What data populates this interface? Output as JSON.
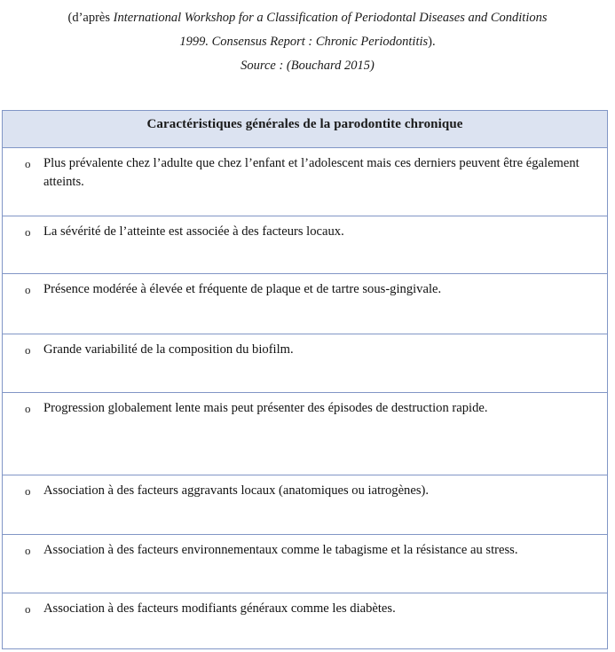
{
  "caption": {
    "line1_prefix": "(d’après ",
    "line1_italic": "International Workshop for a Classification of Periodontal Diseases and Conditions",
    "line2_italic": "1999. Consensus Report : Chronic Periodontitis",
    "line2_suffix": ").",
    "source": "Source : (Bouchard 2015)"
  },
  "table": {
    "header": "Caractéristiques générales de la parodontite chronique",
    "bullet_glyph": "o",
    "header_fill": "#dce3f1",
    "border_color": "#8196c6",
    "rows": [
      "Plus prévalente chez l’adulte que chez l’enfant et l’adolescent mais ces derniers peuvent être également atteints.",
      "La sévérité de l’atteinte est associée à des facteurs locaux.",
      "Présence modérée à élevée et fréquente de plaque et de tartre sous-gingivale.",
      "Grande variabilité de la composition du biofilm.",
      "Progression globalement lente mais peut présenter des épisodes de destruction rapide.",
      "Association à des facteurs aggravants locaux (anatomiques ou iatrogènes).",
      "Association à des facteurs environnementaux comme le tabagisme et la résistance au stress.",
      "Association à des facteurs modifiants généraux comme les diabètes."
    ]
  }
}
